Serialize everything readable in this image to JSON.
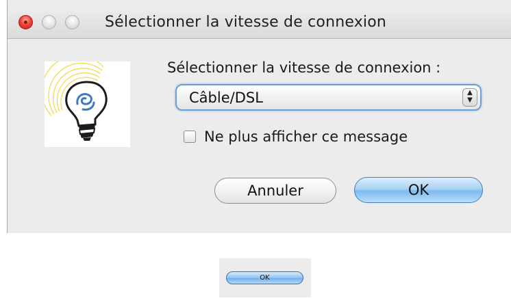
{
  "window": {
    "title": "Sélectionner la vitesse de connexion"
  },
  "dialog": {
    "prompt": "Sélectionner la vitesse de connexion :",
    "speed_select": {
      "selected": "Câble/DSL"
    },
    "checkbox": {
      "label": "Ne plus afficher ce message",
      "checked": false
    },
    "buttons": {
      "cancel": "Annuler",
      "ok": "OK"
    }
  },
  "preview": {
    "ok_label": "OK"
  },
  "icons": {
    "logo": "lightbulb-logo-icon",
    "select_arrows": "up-down-arrows-icon"
  },
  "colors": {
    "accent": "#7fbaf0",
    "close": "#f4443a",
    "logo_blue": "#3c78c4",
    "logo_glow": "#f2d230"
  }
}
